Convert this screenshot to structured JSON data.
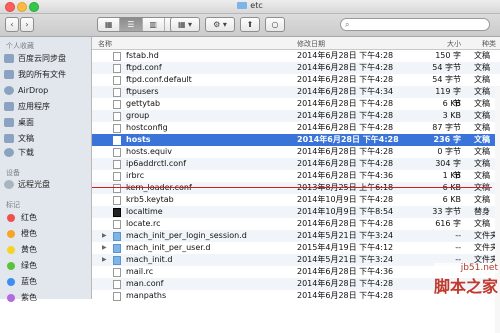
{
  "window": {
    "title": "etc"
  },
  "toolbar": {
    "view_modes": [
      "▦",
      "☰",
      "▥",
      "▤"
    ],
    "arrange_label": "▦ ▾",
    "action_label": "⚙ ▾",
    "share_label": "⬆",
    "tags_label": "○",
    "search_placeholder": ""
  },
  "sidebar": {
    "favorites_heading": "个人收藏",
    "favorites": [
      {
        "label": "百度云同步盘",
        "icon": "cloud-folder-icon"
      },
      {
        "label": "我的所有文件",
        "icon": "all-files-icon"
      },
      {
        "label": "AirDrop",
        "icon": "airdrop-icon"
      },
      {
        "label": "应用程序",
        "icon": "applications-icon"
      },
      {
        "label": "桌面",
        "icon": "desktop-icon"
      },
      {
        "label": "文稿",
        "icon": "documents-icon"
      },
      {
        "label": "下载",
        "icon": "downloads-icon"
      }
    ],
    "devices_heading": "设备",
    "devices": [
      {
        "label": "远程光盘",
        "icon": "remote-disc-icon"
      }
    ],
    "tags_heading": "标记",
    "tags": [
      {
        "label": "红色",
        "color": "#f0504a"
      },
      {
        "label": "橙色",
        "color": "#f5a623"
      },
      {
        "label": "黄色",
        "color": "#f5d327"
      },
      {
        "label": "绿色",
        "color": "#5cc23d"
      },
      {
        "label": "蓝色",
        "color": "#3d8ef0"
      },
      {
        "label": "紫色",
        "color": "#b26be0"
      }
    ]
  },
  "columns": {
    "name": "名称",
    "date": "修改日期",
    "size": "大小",
    "kind": "种类"
  },
  "rows": [
    {
      "name": "fstab.hd",
      "date": "2014年6月28日 下午4:28",
      "size": "150 字节",
      "kind": "文稿",
      "type": "file"
    },
    {
      "name": "ftpd.conf",
      "date": "2014年6月28日 下午4:28",
      "size": "54 字节",
      "kind": "文稿",
      "type": "file"
    },
    {
      "name": "ftpd.conf.default",
      "date": "2014年6月28日 下午4:28",
      "size": "54 字节",
      "kind": "文稿",
      "type": "file"
    },
    {
      "name": "ftpusers",
      "date": "2014年6月28日 下午4:34",
      "size": "119 字节",
      "kind": "文稿",
      "type": "file"
    },
    {
      "name": "gettytab",
      "date": "2014年6月28日 下午4:28",
      "size": "6 KB",
      "kind": "文稿",
      "type": "file"
    },
    {
      "name": "group",
      "date": "2014年6月28日 下午4:28",
      "size": "3 KB",
      "kind": "文稿",
      "type": "file"
    },
    {
      "name": "hostconfig",
      "date": "2014年6月28日 下午4:28",
      "size": "87 字节",
      "kind": "文稿",
      "type": "file"
    },
    {
      "name": "hosts",
      "date": "2014年6月28日 下午4:28",
      "size": "236 字节",
      "kind": "文稿",
      "type": "file",
      "selected": true
    },
    {
      "name": "hosts.equiv",
      "date": "2014年6月28日 下午4:28",
      "size": "0 字节",
      "kind": "文稿",
      "type": "file"
    },
    {
      "name": "ip6addrctl.conf",
      "date": "2014年6月28日 下午4:28",
      "size": "304 字节",
      "kind": "文稿",
      "type": "file"
    },
    {
      "name": "irbrc",
      "date": "2014年6月28日 下午4:36",
      "size": "1 KB",
      "kind": "文稿",
      "type": "file"
    },
    {
      "name": "kern_loader.conf",
      "date": "2013年8月25日 上午6:18",
      "size": "6 KB",
      "kind": "文稿",
      "type": "file"
    },
    {
      "name": "krb5.keytab",
      "date": "2014年10月9日 下午4:28",
      "size": "6 KB",
      "kind": "文稿",
      "type": "file"
    },
    {
      "name": "localtime",
      "date": "2014年10月9日 下午8:54",
      "size": "33 字节",
      "kind": "替身",
      "type": "exe"
    },
    {
      "name": "locate.rc",
      "date": "2014年6月28日 下午4:28",
      "size": "616 字节",
      "kind": "文稿",
      "type": "file"
    },
    {
      "name": "mach_init_per_login_session.d",
      "date": "2014年5月21日 下午3:24",
      "size": "--",
      "kind": "文件夹",
      "type": "dir"
    },
    {
      "name": "mach_init_per_user.d",
      "date": "2015年4月19日 下午4:12",
      "size": "--",
      "kind": "文件夹",
      "type": "dir"
    },
    {
      "name": "mach_init.d",
      "date": "2014年5月21日 下午3:24",
      "size": "--",
      "kind": "文件夹",
      "type": "dir"
    },
    {
      "name": "mail.rc",
      "date": "2014年6月28日 下午4:36",
      "size": "",
      "kind": "",
      "type": "file"
    },
    {
      "name": "man.conf",
      "date": "2014年6月28日 下午4:28",
      "size": "",
      "kind": "",
      "type": "file"
    },
    {
      "name": "manpaths",
      "date": "2014年6月28日 下午4:28",
      "size": "",
      "kind": "",
      "type": "file"
    }
  ],
  "watermark": {
    "url": "jb51.net",
    "name": "脚本之家"
  }
}
